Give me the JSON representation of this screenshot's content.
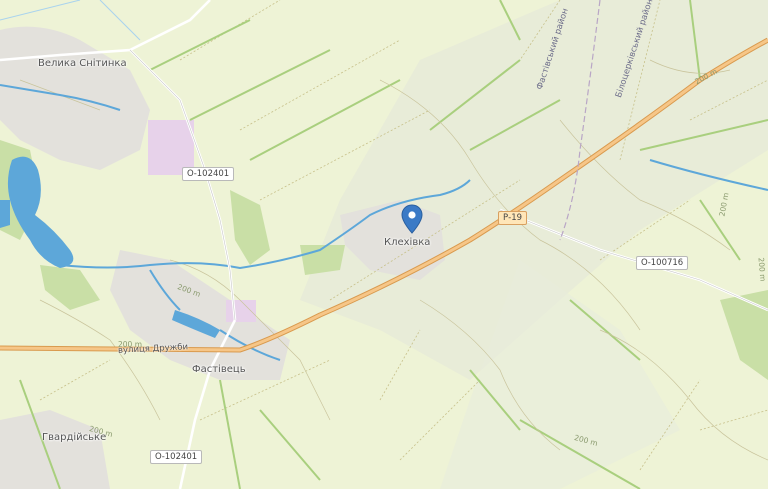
{
  "places": {
    "velyka_snitynka": "Велика Снітинка",
    "klekhivka": "Клехівка",
    "fastivets": "Фастівець",
    "hvardiiske": "Гвардійське"
  },
  "roads": {
    "o102401_top": "О-102401",
    "o102401_bottom": "О-102401",
    "p19": "Р-19",
    "o100716": "О-100716",
    "street_druzhby": "вулиця Дружби"
  },
  "districts": {
    "fastivskyi": "Фастівський район",
    "bilotserkivskyi": "Білоцерківський район"
  },
  "contours": {
    "c1": "200 m",
    "c2": "200 m",
    "c3": "200 m",
    "c4": "200 m",
    "c5": "200 m",
    "c6": "200 m",
    "c7": "200 m"
  },
  "colors": {
    "land": "#eef3d6",
    "water": "#5da7d9",
    "forest": "#c9dfa6",
    "urban": "#e3e1dc",
    "industrial": "#e7d2ea",
    "main_road": "#f2b36a",
    "marker": "#3b7ac6"
  },
  "marker": {
    "icon": "map-pin-icon"
  }
}
